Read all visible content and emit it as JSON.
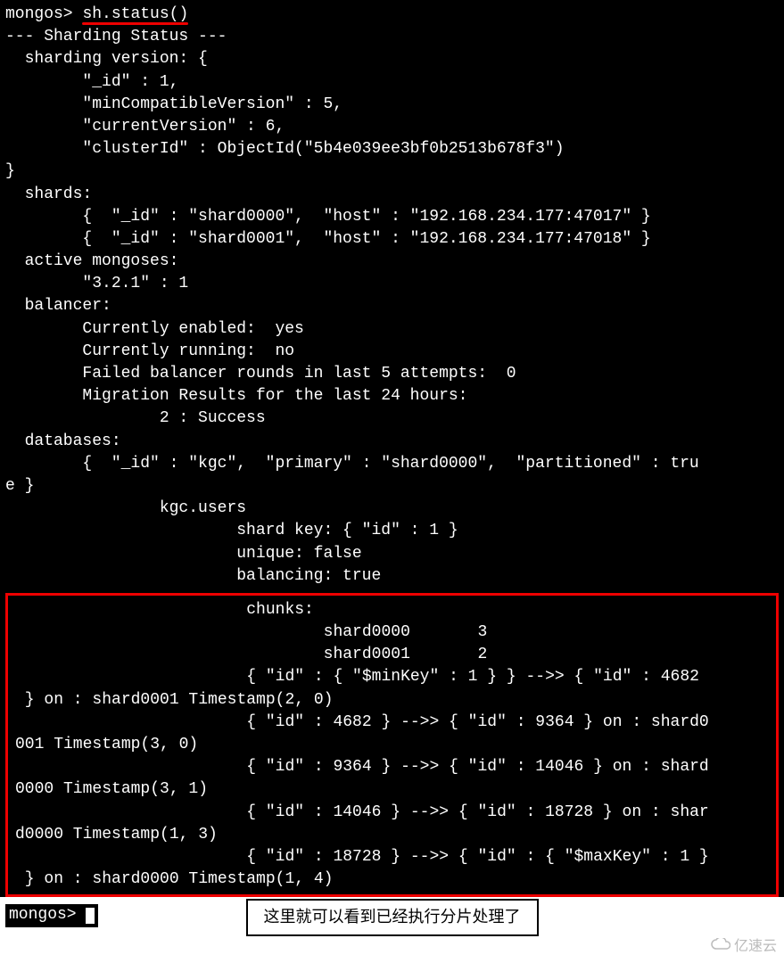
{
  "prompt": "mongos>",
  "cmd": "sh.status()",
  "status_header": "--- Sharding Status ---",
  "sv_label": "  sharding version: {",
  "sv_id": "        \"_id\" : 1,",
  "sv_min": "        \"minCompatibleVersion\" : 5,",
  "sv_cur": "        \"currentVersion\" : 6,",
  "sv_cluster": "        \"clusterId\" : ObjectId(\"5b4e039ee3bf0b2513b678f3\")",
  "sv_close": "}",
  "shards_label": "  shards:",
  "shard0": "        {  \"_id\" : \"shard0000\",  \"host\" : \"192.168.234.177:47017\" }",
  "shard1": "        {  \"_id\" : \"shard0001\",  \"host\" : \"192.168.234.177:47018\" }",
  "mongoses_label": "  active mongoses:",
  "mongoses_val": "        \"3.2.1\" : 1",
  "balancer_label": "  balancer:",
  "bal_enabled": "        Currently enabled:  yes",
  "bal_running": "        Currently running:  no",
  "bal_failed": "        Failed balancer rounds in last 5 attempts:  0",
  "bal_migr": "        Migration Results for the last 24 hours:",
  "bal_migr_val": "                2 : Success",
  "db_label": "  databases:",
  "db_kgc": "        {  \"_id\" : \"kgc\",  \"primary\" : \"shard0000\",  \"partitioned\" : tru\ne }",
  "coll": "                kgc.users",
  "shardkey": "                        shard key: { \"id\" : 1 }",
  "unique": "                        unique: false",
  "balancing": "                        balancing: true",
  "chunks_label": "                        chunks:",
  "chunks_s0": "                                shard0000       3",
  "chunks_s1": "                                shard0001       2",
  "range1": "                        { \"id\" : { \"$minKey\" : 1 } } -->> { \"id\" : 4682\n } on : shard0001 Timestamp(2, 0)",
  "range2": "                        { \"id\" : 4682 } -->> { \"id\" : 9364 } on : shard0\n001 Timestamp(3, 0)",
  "range3": "                        { \"id\" : 9364 } -->> { \"id\" : 14046 } on : shard\n0000 Timestamp(3, 1)",
  "range4": "                        { \"id\" : 14046 } -->> { \"id\" : 18728 } on : shar\nd0000 Timestamp(1, 3)",
  "range5": "                        { \"id\" : 18728 } -->> { \"id\" : { \"$maxKey\" : 1 }\n } on : shard0000 Timestamp(1, 4)",
  "end_prompt": "mongos> ",
  "callout": "这里就可以看到已经执行分片处理了",
  "watermark": "亿速云"
}
